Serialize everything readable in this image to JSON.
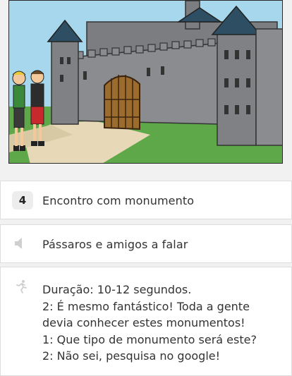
{
  "scene": {
    "description_icon": "castle-scene-illustration"
  },
  "panels": [
    {
      "badge": "4",
      "text": "Encontro com monumento",
      "icon": "number-badge"
    },
    {
      "text": "Pássaros e amigos a falar",
      "icon": "speaker-icon"
    },
    {
      "icon": "running-person-icon",
      "lines": [
        "Duração: 10-12 segundos.",
        "2: É mesmo fantástico! Toda a gente",
        "devia conhecer estes monumentos!",
        "1: Que tipo de monumento será este?",
        "2: Não sei, pesquisa no google!"
      ]
    }
  ],
  "colors": {
    "panel_bg": "#ffffff",
    "page_bg": "#f1f1f1",
    "text": "#333333",
    "badge_bg": "#ededed"
  }
}
